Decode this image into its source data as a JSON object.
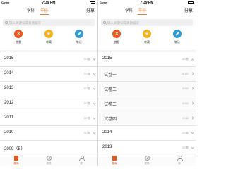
{
  "statusbar": {
    "carrier": "Carrier",
    "time": "7:39 PM"
  },
  "navbar": {
    "tabs": [
      "学科",
      "年份"
    ],
    "active_tab": 1,
    "share_label": "分享"
  },
  "search": {
    "placeholder": "输入关键词或真题编号"
  },
  "actions": [
    {
      "label": "错题",
      "icon": "wrong-icon",
      "color": "#e8571e"
    },
    {
      "label": "收藏",
      "icon": "star-icon",
      "color": "#f4b11c"
    },
    {
      "label": "笔记",
      "icon": "pen-icon",
      "color": "#2e9bd6"
    }
  ],
  "left_list": [
    {
      "label": "2015",
      "count": "307题"
    },
    {
      "label": "2014",
      "count": "307题"
    },
    {
      "label": "2013",
      "count": "307题"
    },
    {
      "label": "2012",
      "count": "307题"
    },
    {
      "label": "2011",
      "count": "307题"
    },
    {
      "label": "2010",
      "count": "307题"
    },
    {
      "label": "2009（B）",
      "count": ""
    }
  ],
  "right_list": [
    {
      "label": "2015",
      "count": "307题",
      "expanded": true
    },
    {
      "label": "试卷一",
      "count": "10/102",
      "sub": true
    },
    {
      "label": "试卷二",
      "count": "0/102",
      "sub": true
    },
    {
      "label": "试卷三",
      "count": "0/102",
      "sub": true
    },
    {
      "label": "试卷四",
      "count": "0/102",
      "sub": true
    },
    {
      "label": "2014",
      "count": "307题"
    },
    {
      "label": "2013",
      "count": "307题"
    },
    {
      "label": "2012",
      "count": "307题"
    }
  ],
  "tabbar": [
    {
      "label": "题库",
      "icon": "document-icon",
      "active": true
    },
    {
      "label": "发现",
      "icon": "compass-icon",
      "active": false
    },
    {
      "label": "我",
      "icon": "person-icon",
      "active": false
    }
  ],
  "colors": {
    "accent": "#f07b2a",
    "wrong": "#e8571e",
    "favorite": "#f4b11c",
    "note": "#2e9bd6"
  }
}
